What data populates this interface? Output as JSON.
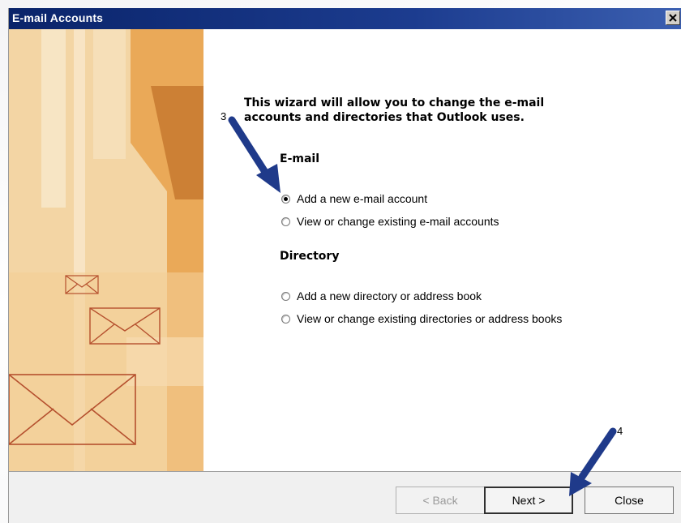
{
  "window": {
    "title": "E-mail Accounts"
  },
  "wizard": {
    "heading": "This wizard will allow you to change the e-mail accounts and directories that Outlook uses.",
    "email_section": {
      "label": "E-mail",
      "options": [
        {
          "label": "Add a new e-mail account",
          "checked": true
        },
        {
          "label": "View or change existing e-mail accounts",
          "checked": false
        }
      ]
    },
    "directory_section": {
      "label": "Directory",
      "options": [
        {
          "label": "Add a new directory or address book",
          "checked": false
        },
        {
          "label": "View or change existing directories or address books",
          "checked": false
        }
      ]
    }
  },
  "buttons": {
    "back": "< Back",
    "next": "Next >",
    "close": "Close"
  },
  "annotations": {
    "step_3": "3",
    "step_4": "4"
  },
  "colors": {
    "titlebar": "#0a246a",
    "arrow": "#1f3a8a",
    "art_orange": "#f0c27e"
  }
}
